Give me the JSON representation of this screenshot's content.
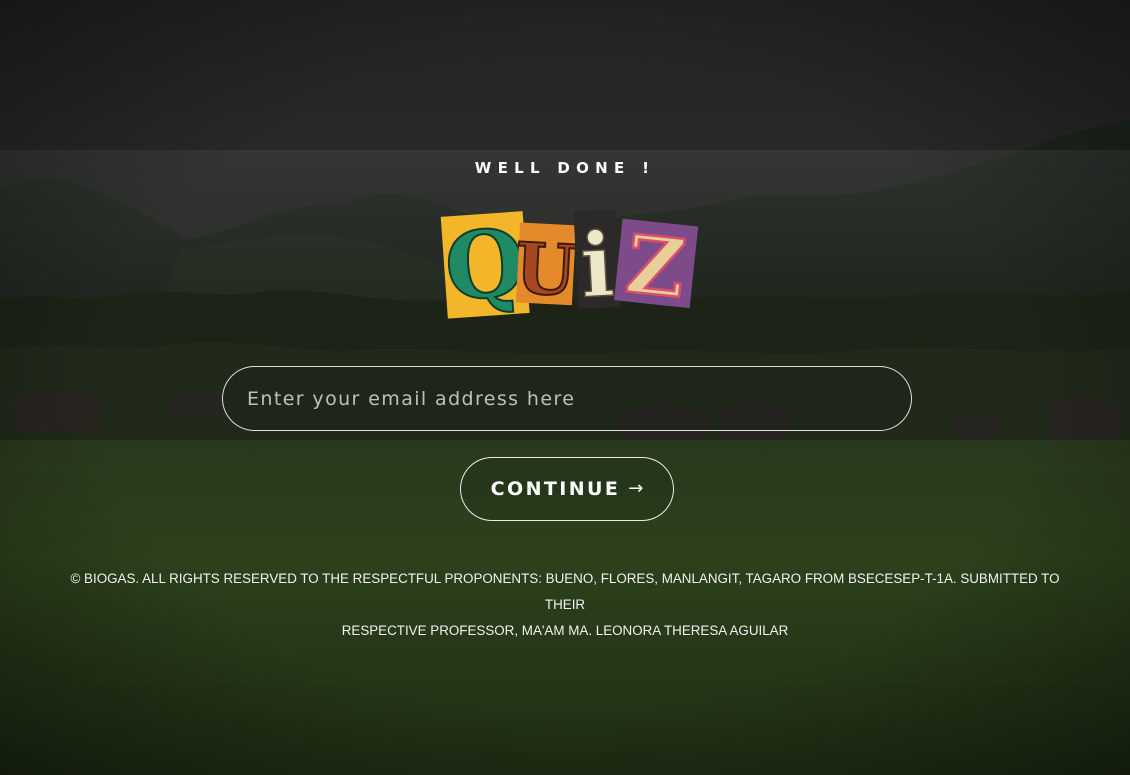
{
  "heading": "WELL DONE !",
  "logo": {
    "letters": [
      "Q",
      "U",
      "i",
      "Z"
    ]
  },
  "email": {
    "placeholder": "Enter your email address here",
    "value": ""
  },
  "continue_button": {
    "label": "CONTINUE",
    "icon": "arrow-right-icon",
    "glyph": "→"
  },
  "footer": {
    "line1": "© BIOGAS. ALL RIGHTS RESERVED TO THE RESPECTFUL PROPONENTS: BUENO, FLORES, MANLANGIT, TAGARO FROM BSECESEP-T-1A. SUBMITTED TO THEIR",
    "line2": "RESPECTIVE PROFESSOR, MA'AM MA. LEONORA THERESA AGUILAR"
  },
  "colors": {
    "sky": "#3b3d3b",
    "mountain": "#2e3a2c",
    "field": "#3f5a2a",
    "button_border": "#ffffff",
    "text": "#ffffff"
  }
}
